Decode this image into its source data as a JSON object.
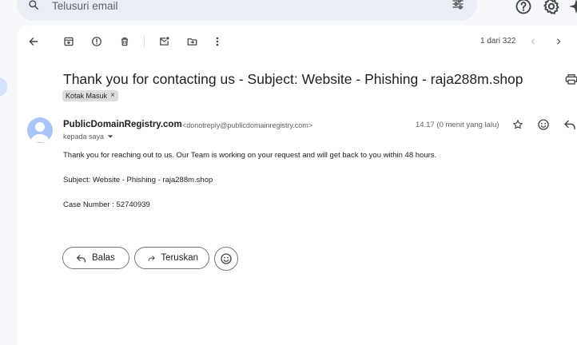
{
  "search": {
    "placeholder": "Telusuri email"
  },
  "pager": {
    "text": "1 dari 322"
  },
  "message": {
    "subject": "Thank you for contacting us - Subject: Website - Phishing - raja288m.shop",
    "label": "Kotak Masuk",
    "sender_name": "PublicDomainRegistry.com",
    "sender_email": "<donotreply@publicdomainregistry.com>",
    "recipient": "kepada saya",
    "time": "14.17 (0 menit yang lalu)",
    "body": [
      "Thank you for reaching out to us. Our Team is working on your request and will get back to you within 48 hours.",
      "Subject: Website - Phishing - raja288m.shop",
      "Case Number : 52740939"
    ]
  },
  "actions": {
    "reply_label": "Balas",
    "forward_label": "Teruskan"
  },
  "colors": {
    "accent_light": "#d3e3fd",
    "avatar": "#a9c5f7",
    "background": "#f6f8fc"
  }
}
